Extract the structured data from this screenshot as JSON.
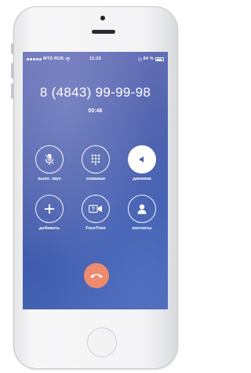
{
  "status_bar": {
    "carrier": "MTS RUS",
    "time": "11:29",
    "battery": "84 %"
  },
  "call": {
    "number": "8 (4843) 99-99-98",
    "duration": "00:46"
  },
  "buttons": [
    {
      "label": "выкл. звук",
      "icon": "mute-icon",
      "active": false
    },
    {
      "label": "клавиши",
      "icon": "keypad-icon",
      "active": false
    },
    {
      "label": "динамик",
      "icon": "speaker-icon",
      "active": true
    },
    {
      "label": "добавить",
      "icon": "plus-icon",
      "active": false
    },
    {
      "label": "FaceTime",
      "icon": "facetime-icon",
      "active": false
    },
    {
      "label": "контакты",
      "icon": "contact-icon",
      "active": false
    }
  ],
  "end_call": {
    "icon": "end-call-icon",
    "color": "#ee8a6e"
  },
  "colors": {
    "screen_bg": "#4d61ad",
    "end_call": "#ee8a6e",
    "phone_body": "#f3f3f5"
  }
}
